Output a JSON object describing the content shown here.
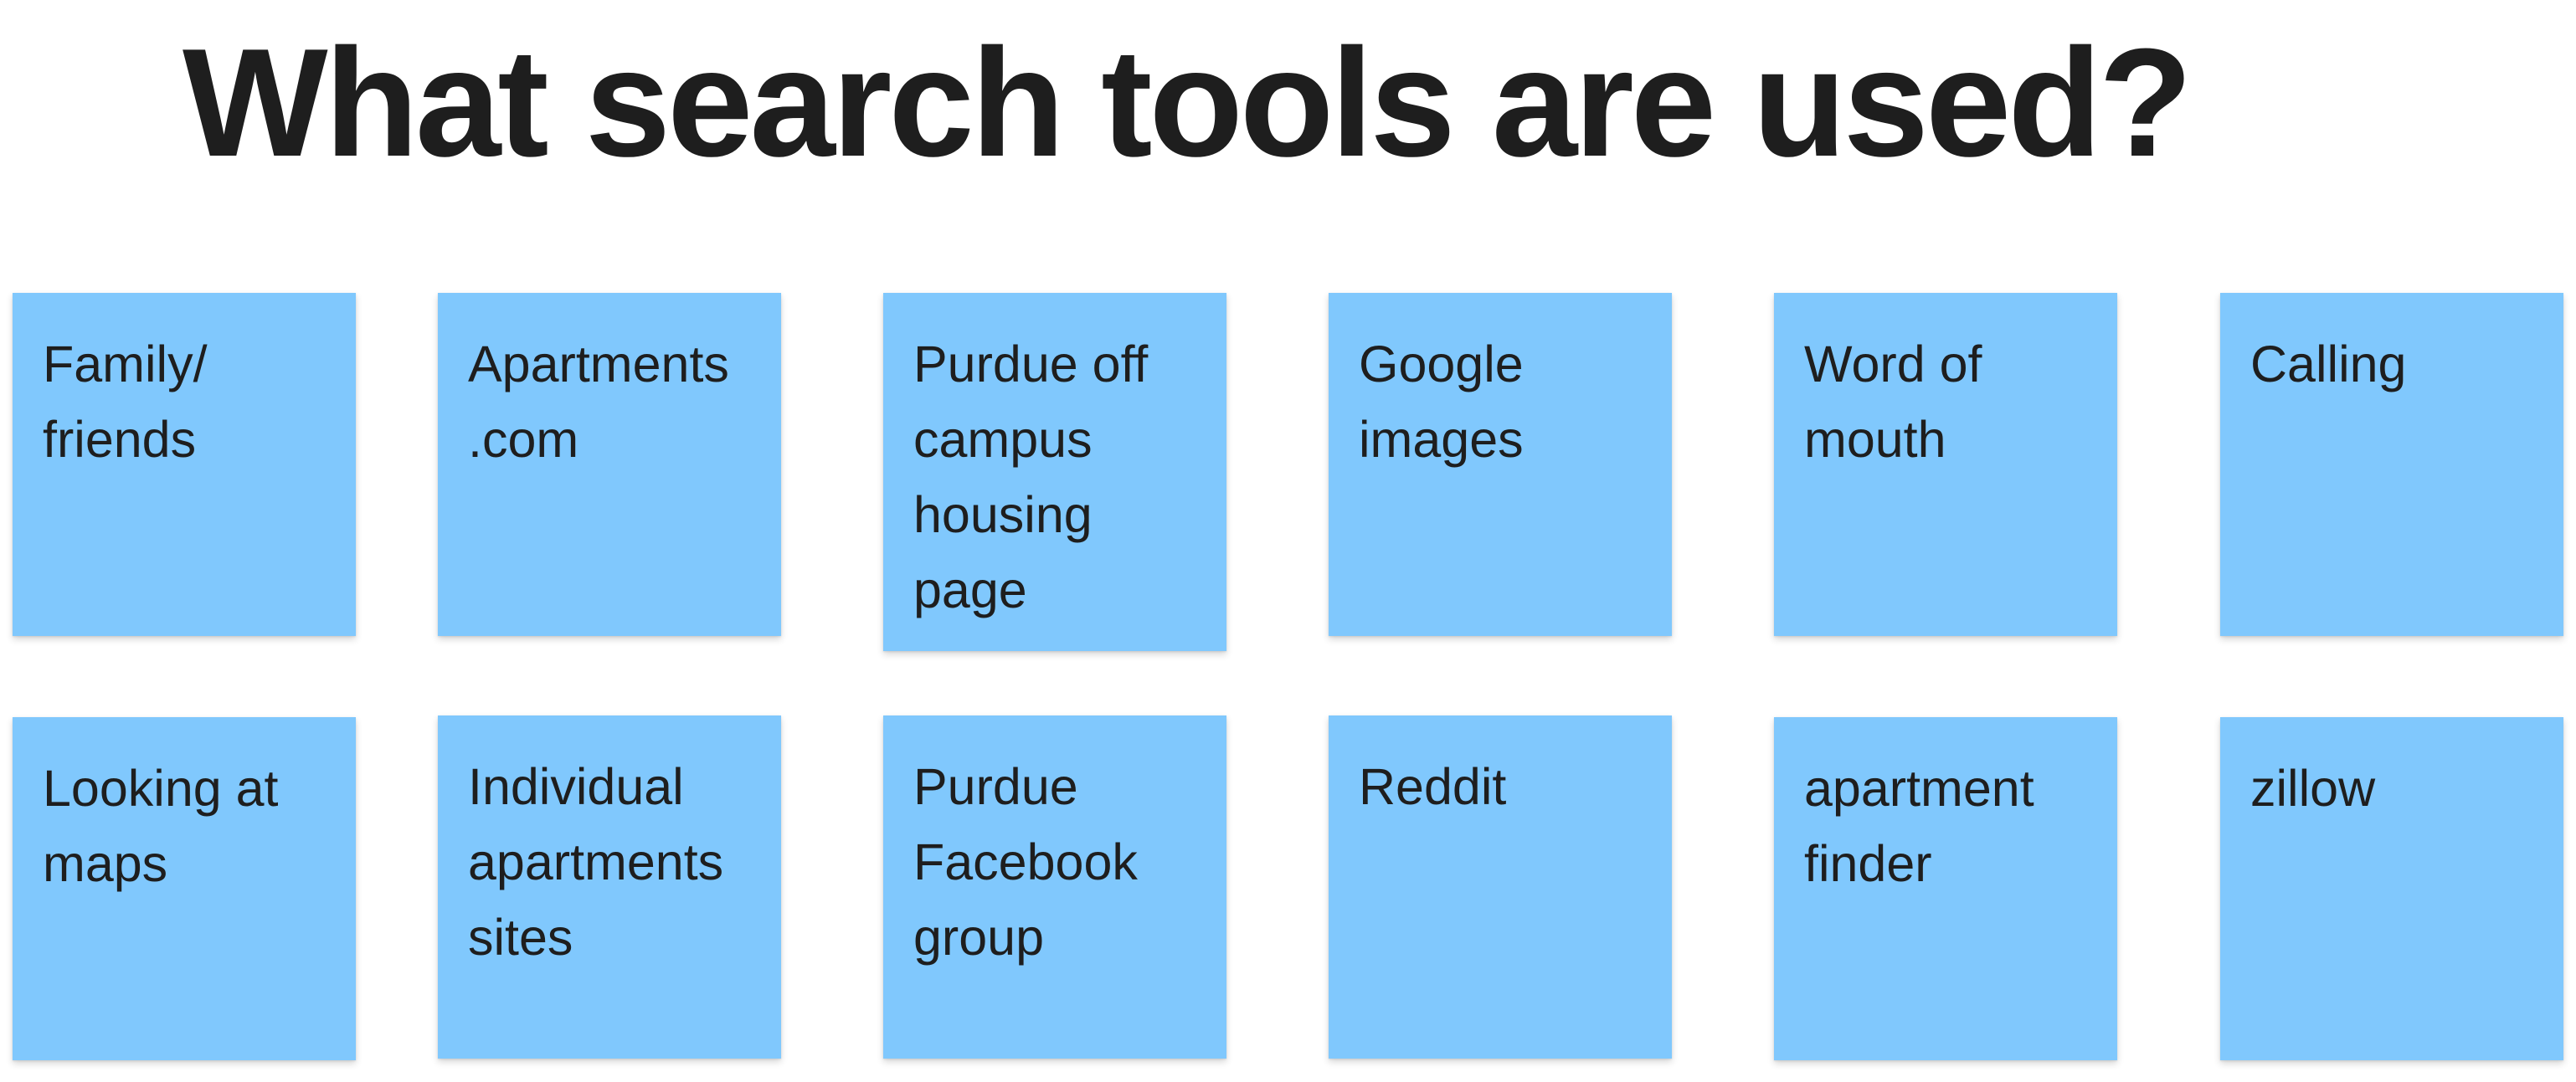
{
  "board": {
    "title": "What search tools are used?",
    "note_color": "#80c8fd",
    "text_color": "#1e1e1e"
  },
  "notes": [
    {
      "text": "Family/\nfriends"
    },
    {
      "text": "Apartments\n.com"
    },
    {
      "text": "Purdue off\ncampus\nhousing\npage"
    },
    {
      "text": "Google\nimages"
    },
    {
      "text": "Word of\nmouth"
    },
    {
      "text": "Calling"
    },
    {
      "text": "Looking at\nmaps"
    },
    {
      "text": "Individual\napartments\nsites"
    },
    {
      "text": "Purdue\nFacebook\ngroup"
    },
    {
      "text": "Reddit"
    },
    {
      "text": "apartment\nfinder"
    },
    {
      "text": "zillow"
    }
  ]
}
